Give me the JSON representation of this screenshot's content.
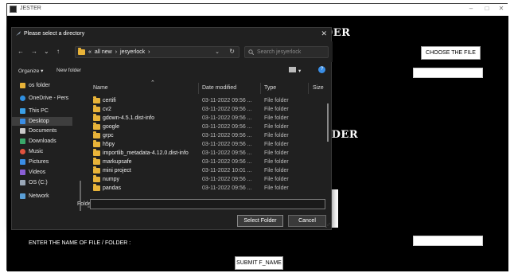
{
  "app": {
    "title": "JESTER",
    "minimize": "–",
    "maximize": "□",
    "close": "✕",
    "heading_top": "DER",
    "heading_mid": "LDER",
    "choose_file_label": "CHOOSE THE FILE",
    "enter_name_label": "ENTER THE NAME OF FILE / FOLDER :",
    "submit_label": "SUBMIT F_NAME"
  },
  "dialog": {
    "title": "Please select a directory",
    "close": "✕",
    "nav": {
      "back": "←",
      "forward": "→",
      "recent": "⌄",
      "up": "↑"
    },
    "breadcrumb": [
      "«",
      "all new",
      "›",
      "jesyerlock",
      "›"
    ],
    "address_dropdown": "⌄",
    "refresh": "↻",
    "search_placeholder": "Search jesyerlock",
    "organize_label": "Organize ▾",
    "new_folder_label": "New folder",
    "help": "?",
    "sidebar": [
      {
        "label": "os folder",
        "icon": "folder-icon"
      },
      {
        "label": "OneDrive - Pers",
        "icon": "cloud-icon"
      },
      {
        "label": "This PC",
        "icon": "pc-icon"
      },
      {
        "label": "Desktop",
        "icon": "desktop-icon"
      },
      {
        "label": "Documents",
        "icon": "document-icon"
      },
      {
        "label": "Downloads",
        "icon": "download-icon"
      },
      {
        "label": "Music",
        "icon": "music-icon"
      },
      {
        "label": "Pictures",
        "icon": "picture-icon"
      },
      {
        "label": "Videos",
        "icon": "video-icon"
      },
      {
        "label": "OS (C:)",
        "icon": "drive-icon"
      },
      {
        "label": "Network",
        "icon": "network-icon"
      }
    ],
    "columns": {
      "name": "Name",
      "date": "Date modified",
      "type": "Type",
      "size": "Size"
    },
    "sort_arrow": "⌃",
    "files": [
      {
        "name": "certifi",
        "date": "03-11-2022 09:56 ...",
        "type": "File folder"
      },
      {
        "name": "cv2",
        "date": "03-11-2022 09:56 ...",
        "type": "File folder"
      },
      {
        "name": "gdown-4.5.1.dist-info",
        "date": "03-11-2022 09:56 ...",
        "type": "File folder"
      },
      {
        "name": "google",
        "date": "03-11-2022 09:56 ...",
        "type": "File folder"
      },
      {
        "name": "grpc",
        "date": "03-11-2022 09:56 ...",
        "type": "File folder"
      },
      {
        "name": "h5py",
        "date": "03-11-2022 09:56 ...",
        "type": "File folder"
      },
      {
        "name": "importlib_metadata-4.12.0.dist-info",
        "date": "03-11-2022 09:56 ...",
        "type": "File folder"
      },
      {
        "name": "markupsafe",
        "date": "03-11-2022 09:56 ...",
        "type": "File folder"
      },
      {
        "name": "mini project",
        "date": "03-11-2022 10:01 ...",
        "type": "File folder"
      },
      {
        "name": "numpy",
        "date": "03-11-2022 09:56 ...",
        "type": "File folder"
      },
      {
        "name": "pandas",
        "date": "03-11-2022 09:56 ...",
        "type": "File folder"
      }
    ],
    "folder_label": "Folder:",
    "folder_value": "",
    "select_label": "Select Folder",
    "cancel_label": "Cancel"
  }
}
